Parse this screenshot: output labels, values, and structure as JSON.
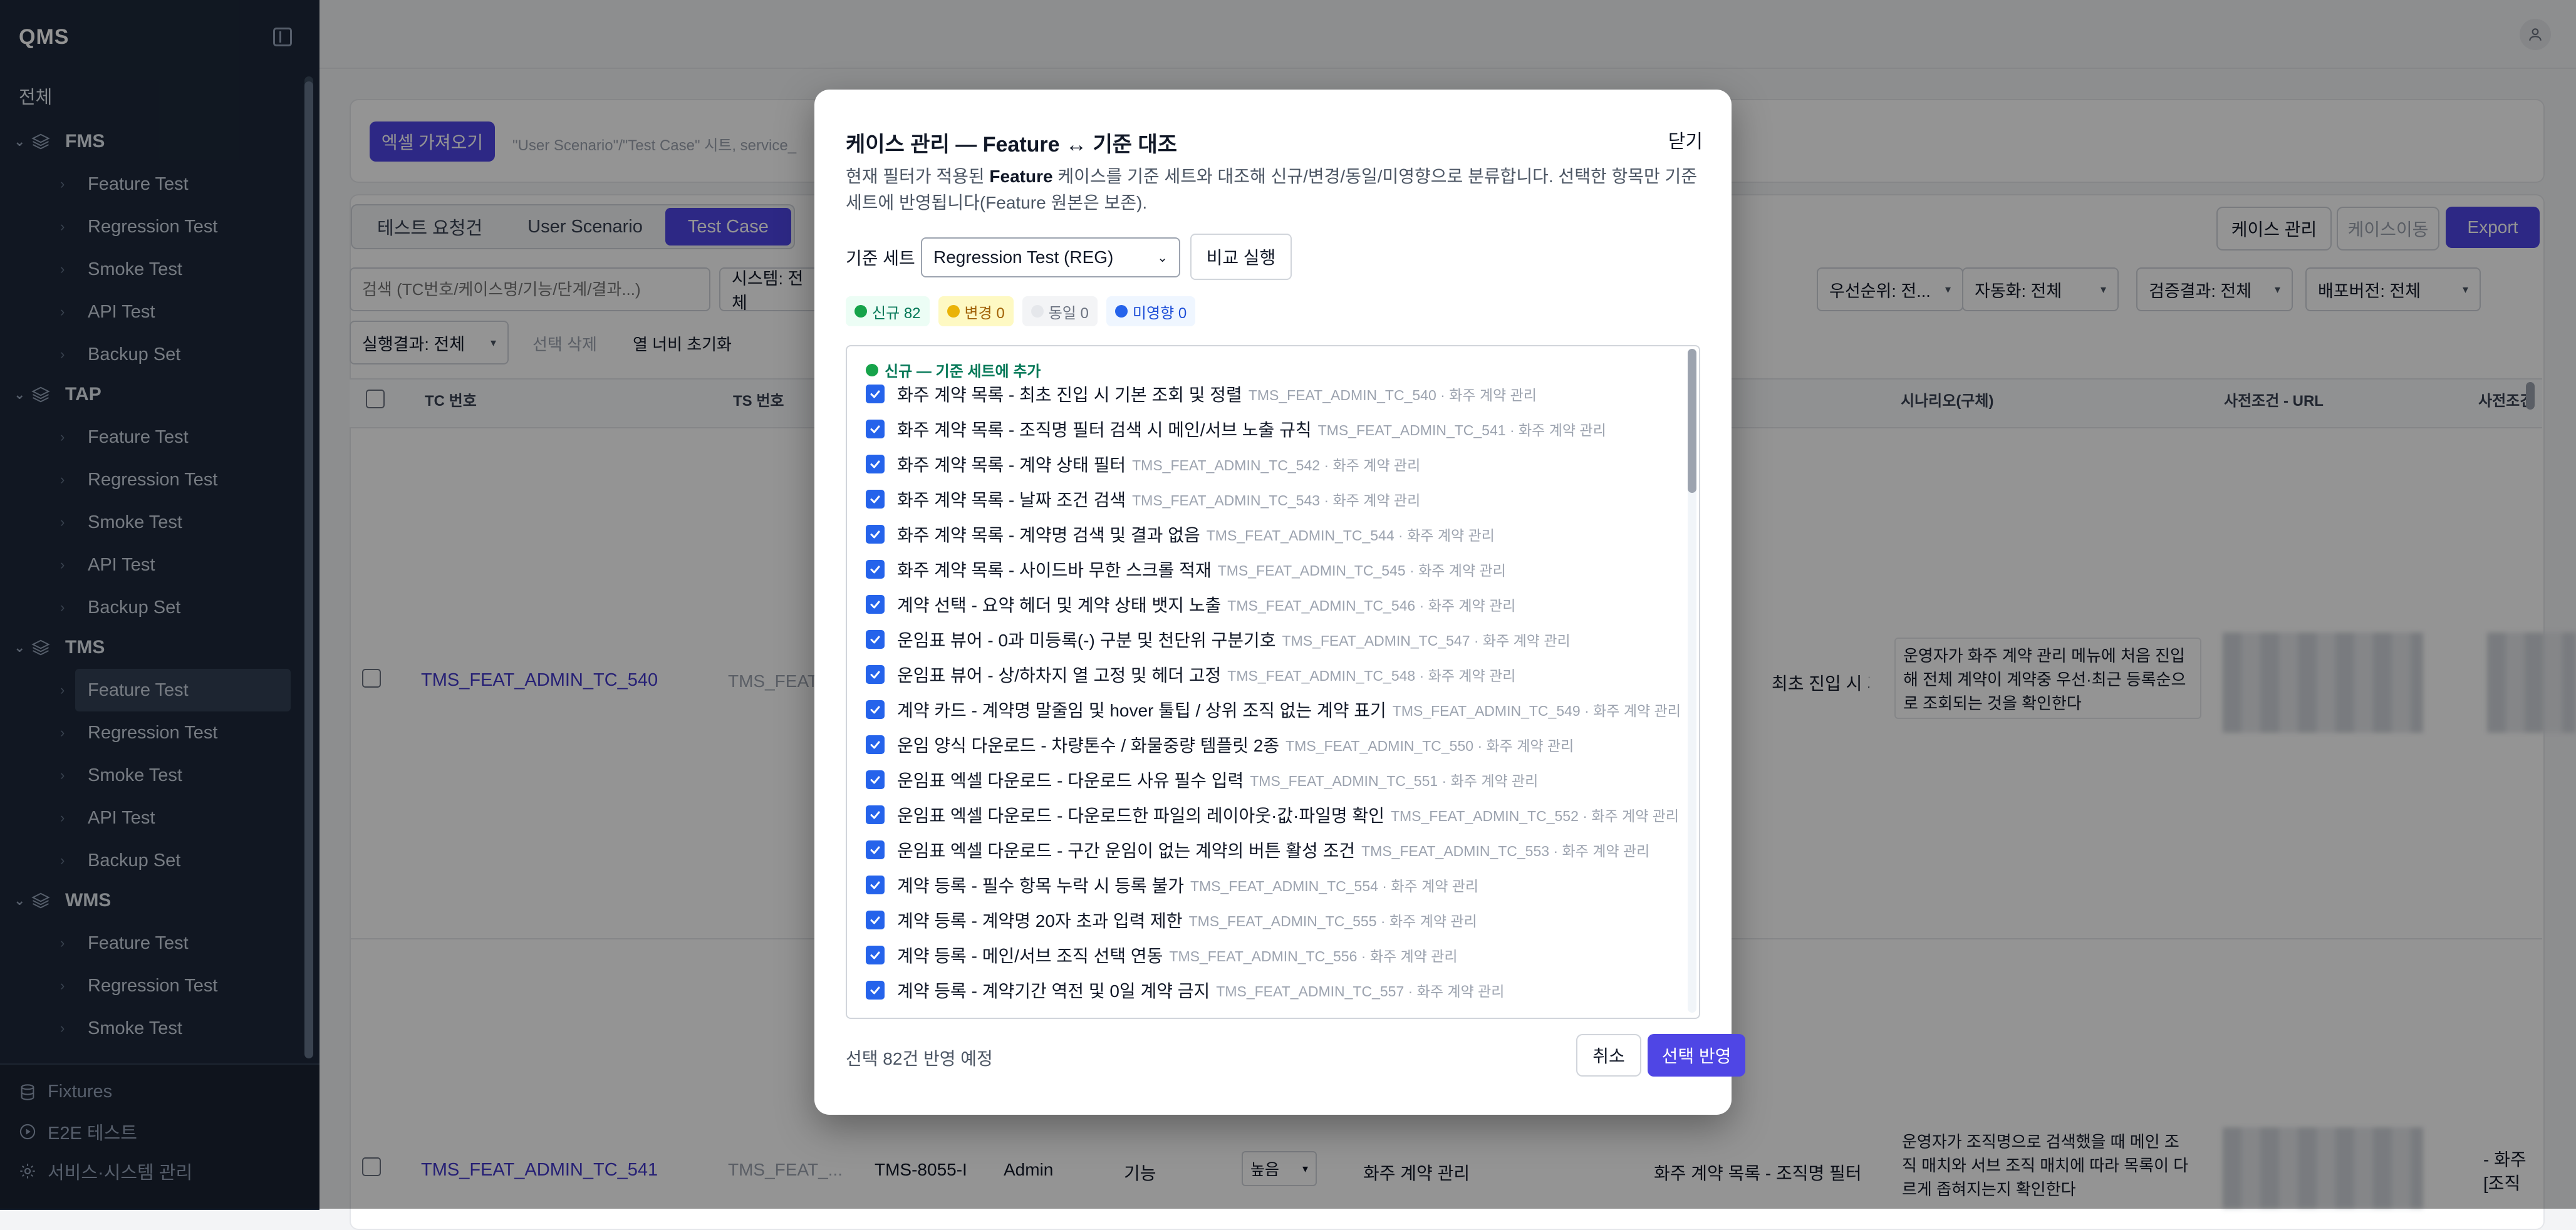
{
  "sidebar": {
    "title": "QMS",
    "all_label": "전체",
    "groups": [
      {
        "name": "FMS",
        "items": [
          "Feature Test",
          "Regression Test",
          "Smoke Test",
          "API Test",
          "Backup Set"
        ]
      },
      {
        "name": "TAP",
        "items": [
          "Feature Test",
          "Regression Test",
          "Smoke Test",
          "API Test",
          "Backup Set"
        ]
      },
      {
        "name": "TMS",
        "items": [
          "Feature Test",
          "Regression Test",
          "Smoke Test",
          "API Test",
          "Backup Set"
        ]
      },
      {
        "name": "WMS",
        "items": [
          "Feature Test",
          "Regression Test",
          "Smoke Test"
        ]
      }
    ],
    "bottom": [
      "Fixtures",
      "E2E 테스트",
      "서비스·시스템 관리"
    ]
  },
  "background": {
    "import_button": "엑셀 가져오기",
    "import_hint": "\"User Scenario\"/\"Test Case\" 시트, service_",
    "tabs": [
      "테스트 요청건",
      "User Scenario",
      "Test Case"
    ],
    "active_tab": "Test Case",
    "actions": {
      "manage": "케이스 관리",
      "move": "케이스이동",
      "export": "Export"
    },
    "search_placeholder": "검색 (TC번호/케이스명/기능/단계/결과...)",
    "filters": {
      "system": "시스템: 전체",
      "priority": "우선순위: 전...",
      "automation": "자동화: 전체",
      "verify": "검증결과: 전체",
      "release": "배포버전: 전체",
      "exec": "실행결과: 전체",
      "delete_selected": "선택 삭제",
      "reset_width": "열 너비 초기화"
    },
    "columns": {
      "tc": "TC 번호",
      "ts": "TS 번호",
      "scenario": "시나리오(구체)",
      "pre_url": "사전조건 - URL",
      "pre": "사전조건"
    },
    "rows": [
      {
        "tc": "TMS_FEAT_ADMIN_TC_540",
        "ts": "TMS_FEAT",
        "title_partial": "최초 진입 시 기",
        "scenario": "운영자가 화주 계약 관리 메뉴에 처음 진입해 전체 계약이 계약중 우선·최근 등록순으로 조회되는 것을 확인한다"
      },
      {
        "tc": "TMS_FEAT_ADMIN_TC_541",
        "ts": "TMS_FEAT_...",
        "req": "TMS-8055-I",
        "role": "Admin",
        "type": "기능",
        "priority": "높음",
        "menu": "화주 계약 관리",
        "title_partial": "화주 계약 목록 - 조직명 필터 검",
        "scenario": "운영자가 조직명으로 검색했을 때 메인 조직 매치와 서브 조직 매치에 따라 목록이 다르게 좁혀지는지 확인한다",
        "pre": "- 화주",
        "pre2": "[조직"
      }
    ]
  },
  "modal": {
    "title": "케이스 관리 — Feature ↔ 기준 대조",
    "close": "닫기",
    "desc_prefix": "현재 필터가 적용된 ",
    "desc_bold": "Feature",
    "desc_suffix": " 케이스를 기준 세트와 대조해 신규/변경/동일/미영향으로 분류합니다. 선택한 항목만 기준 세트에 반영됩니다(Feature 원본은 보존).",
    "base_label": "기준 세트",
    "base_value": "Regression Test (REG)",
    "compare_button": "비교 실행",
    "badges": {
      "new": "신규 82",
      "changed": "변경 0",
      "same": "동일 0",
      "none": "미영향 0"
    },
    "section_title": "신규 — 기준 세트에 추가",
    "items": [
      {
        "name": "화주 계약 목록 - 최초 진입 시 기본 조회 및 정렬",
        "meta": "TMS_FEAT_ADMIN_TC_540 · 화주 계약 관리"
      },
      {
        "name": "화주 계약 목록 - 조직명 필터 검색 시 메인/서브 노출 규칙",
        "meta": "TMS_FEAT_ADMIN_TC_541 · 화주 계약 관리"
      },
      {
        "name": "화주 계약 목록 - 계약 상태 필터",
        "meta": "TMS_FEAT_ADMIN_TC_542 · 화주 계약 관리"
      },
      {
        "name": "화주 계약 목록 - 날짜 조건 검색",
        "meta": "TMS_FEAT_ADMIN_TC_543 · 화주 계약 관리"
      },
      {
        "name": "화주 계약 목록 - 계약명 검색 및 결과 없음",
        "meta": "TMS_FEAT_ADMIN_TC_544 · 화주 계약 관리"
      },
      {
        "name": "화주 계약 목록 - 사이드바 무한 스크롤 적재",
        "meta": "TMS_FEAT_ADMIN_TC_545 · 화주 계약 관리"
      },
      {
        "name": "계약 선택 - 요약 헤더 및 계약 상태 뱃지 노출",
        "meta": "TMS_FEAT_ADMIN_TC_546 · 화주 계약 관리"
      },
      {
        "name": "운임표 뷰어 - 0과 미등록(-) 구분 및 천단위 구분기호",
        "meta": "TMS_FEAT_ADMIN_TC_547 · 화주 계약 관리"
      },
      {
        "name": "운임표 뷰어 - 상/하차지 열 고정 및 헤더 고정",
        "meta": "TMS_FEAT_ADMIN_TC_548 · 화주 계약 관리"
      },
      {
        "name": "계약 카드 - 계약명 말줄임 및 hover 툴팁 / 상위 조직 없는 계약 표기",
        "meta": "TMS_FEAT_ADMIN_TC_549 · 화주 계약 관리"
      },
      {
        "name": "운임 양식 다운로드 - 차량톤수 / 화물중량 템플릿 2종",
        "meta": "TMS_FEAT_ADMIN_TC_550 · 화주 계약 관리"
      },
      {
        "name": "운임표 엑셀 다운로드 - 다운로드 사유 필수 입력",
        "meta": "TMS_FEAT_ADMIN_TC_551 · 화주 계약 관리"
      },
      {
        "name": "운임표 엑셀 다운로드 - 다운로드한 파일의 레이아웃·값·파일명 확인",
        "meta": "TMS_FEAT_ADMIN_TC_552 · 화주 계약 관리"
      },
      {
        "name": "운임표 엑셀 다운로드 - 구간 운임이 없는 계약의 버튼 활성 조건",
        "meta": "TMS_FEAT_ADMIN_TC_553 · 화주 계약 관리"
      },
      {
        "name": "계약 등록 - 필수 항목 누락 시 등록 불가",
        "meta": "TMS_FEAT_ADMIN_TC_554 · 화주 계약 관리"
      },
      {
        "name": "계약 등록 - 계약명 20자 초과 입력 제한",
        "meta": "TMS_FEAT_ADMIN_TC_555 · 화주 계약 관리"
      },
      {
        "name": "계약 등록 - 메인/서브 조직 선택 연동",
        "meta": "TMS_FEAT_ADMIN_TC_556 · 화주 계약 관리"
      },
      {
        "name": "계약 등록 - 계약기간 역전 및 0일 계약 금지",
        "meta": "TMS_FEAT_ADMIN_TC_557 · 화주 계약 관리"
      }
    ],
    "footer_text": "선택 82건 반영 예정",
    "cancel": "취소",
    "apply": "선택 반영"
  }
}
